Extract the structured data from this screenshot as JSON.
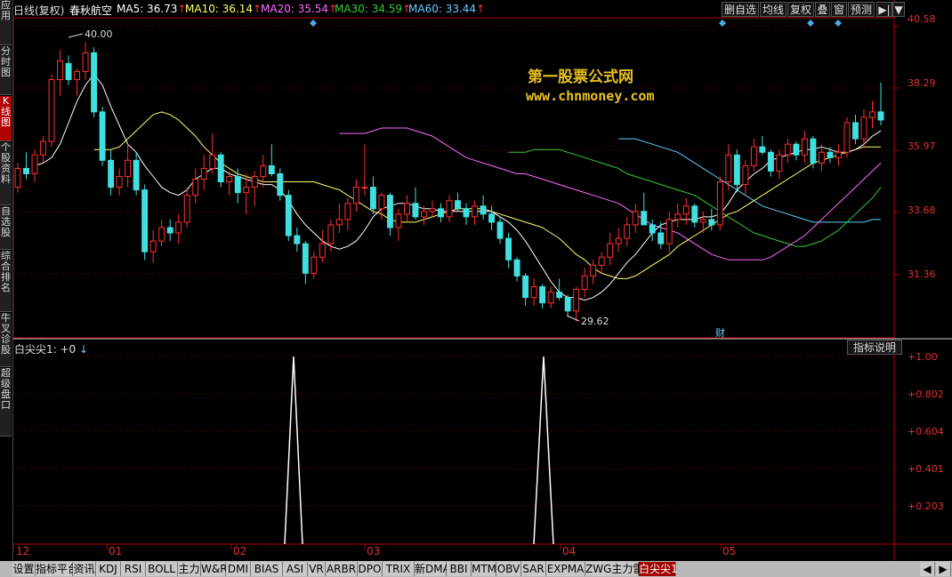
{
  "sidebar": {
    "items": [
      {
        "label": "应用",
        "active": false
      },
      {
        "label": "分时图",
        "active": false
      },
      {
        "label": "K线图",
        "active": true
      },
      {
        "label": "个股资料",
        "active": false
      },
      {
        "label": "自选股",
        "active": false
      },
      {
        "label": "综合排名",
        "active": false
      },
      {
        "label": "牛叉诊股",
        "active": false
      },
      {
        "label": "超级盘口",
        "active": false
      }
    ]
  },
  "header": {
    "period": "日线(复权)",
    "stock": "春秋航空",
    "ma5": {
      "label": "MA5: 36.73",
      "color": "#ffffff"
    },
    "ma10": {
      "label": "MA10: 36.14",
      "color": "#ffff66"
    },
    "ma20": {
      "label": "MA20: 35.54",
      "color": "#ff66ff"
    },
    "ma30": {
      "label": "MA30: 34.59",
      "color": "#33cc33"
    },
    "ma60": {
      "label": "MA60: 33.44",
      "color": "#66ccff"
    },
    "arrow": "↑"
  },
  "toolbar": {
    "buttons": [
      "删自选",
      "均线",
      "复权",
      "叠",
      "窗",
      "预测"
    ],
    "nav": "▶|",
    "dropdown": "▼"
  },
  "watermark": {
    "title": "第一股票公式网",
    "url": "www.chnmoney.com"
  },
  "price_axis": [
    "40.58",
    "38.29",
    "35.97",
    "33.68",
    "31.36"
  ],
  "annotations": {
    "high": "40.00",
    "low": "29.62",
    "fin": "财"
  },
  "indicator": {
    "title": "白尖尖1: +0",
    "arrow": "↓",
    "help_button": "指标说明",
    "axis": [
      "+1.00",
      "+0.802",
      "+0.604",
      "+0.401",
      "+0.203"
    ]
  },
  "months": [
    "12",
    "01",
    "02",
    "03",
    "04",
    "05"
  ],
  "tabs": [
    "设置",
    "指标平台",
    "资讯",
    "KDJ",
    "RSI",
    "BOLL",
    "主力",
    "W&R",
    "DMI",
    "BIAS",
    "ASI",
    "VR",
    "ARBR",
    "DPO",
    "TRIX",
    "新DMA",
    "BBI",
    "MTM",
    "OBV",
    "SAR",
    "EXPMA",
    "ZWG主力雷达",
    "白尖尖1"
  ],
  "active_tab": "白尖尖1",
  "colors": {
    "up": "#ff3030",
    "down": "#40e0e0",
    "grid": "#7a0000",
    "axis": "#b00000"
  },
  "chart_data": {
    "type": "candlestick",
    "ylim": [
      29.0,
      40.9
    ],
    "candles": [
      [
        34.6,
        35.5,
        34.4,
        35.3
      ],
      [
        35.3,
        35.9,
        34.9,
        35.1
      ],
      [
        35.1,
        36.0,
        34.8,
        35.8
      ],
      [
        35.8,
        36.5,
        35.5,
        36.3
      ],
      [
        36.3,
        38.8,
        36.1,
        38.6
      ],
      [
        38.6,
        39.7,
        38.0,
        39.3
      ],
      [
        39.2,
        39.5,
        38.4,
        38.6
      ],
      [
        38.6,
        39.0,
        38.0,
        38.9
      ],
      [
        38.9,
        40.0,
        38.6,
        39.6
      ],
      [
        39.6,
        39.8,
        37.2,
        37.4
      ],
      [
        37.4,
        37.6,
        35.4,
        35.6
      ],
      [
        35.6,
        36.0,
        34.3,
        34.6
      ],
      [
        34.6,
        35.3,
        34.3,
        35.0
      ],
      [
        35.0,
        36.2,
        34.6,
        35.6
      ],
      [
        35.6,
        35.9,
        34.3,
        34.5
      ],
      [
        34.5,
        34.7,
        31.9,
        32.2
      ],
      [
        32.2,
        33.0,
        31.8,
        32.6
      ],
      [
        32.6,
        33.4,
        32.4,
        33.1
      ],
      [
        33.1,
        33.4,
        32.6,
        32.9
      ],
      [
        32.9,
        33.6,
        32.5,
        33.3
      ],
      [
        33.3,
        34.6,
        33.1,
        34.3
      ],
      [
        34.3,
        35.3,
        34.0,
        34.9
      ],
      [
        34.9,
        35.8,
        34.5,
        35.3
      ],
      [
        35.3,
        36.6,
        35.1,
        35.8
      ],
      [
        35.8,
        35.9,
        34.6,
        34.8
      ],
      [
        34.8,
        35.2,
        34.3,
        35.0
      ],
      [
        35.0,
        35.3,
        34.0,
        34.4
      ],
      [
        34.4,
        35.1,
        33.6,
        34.6
      ],
      [
        34.6,
        35.2,
        33.9,
        35.0
      ],
      [
        35.0,
        35.8,
        34.6,
        35.4
      ],
      [
        35.4,
        36.2,
        35.0,
        35.1
      ],
      [
        35.1,
        35.3,
        34.1,
        34.3
      ],
      [
        34.3,
        34.5,
        32.6,
        32.8
      ],
      [
        32.8,
        33.1,
        32.2,
        32.5
      ],
      [
        32.5,
        32.6,
        31.0,
        31.4
      ],
      [
        31.4,
        32.2,
        31.2,
        32.0
      ],
      [
        32.0,
        33.0,
        31.8,
        32.5
      ],
      [
        32.5,
        33.4,
        32.2,
        33.2
      ],
      [
        33.2,
        34.0,
        32.9,
        33.4
      ],
      [
        33.4,
        34.2,
        33.0,
        34.0
      ],
      [
        34.0,
        34.9,
        33.7,
        34.6
      ],
      [
        34.6,
        36.2,
        34.3,
        34.6
      ],
      [
        34.6,
        35.0,
        33.6,
        33.8
      ],
      [
        33.8,
        34.4,
        33.4,
        34.3
      ],
      [
        34.3,
        34.4,
        32.8,
        33.1
      ],
      [
        33.1,
        33.8,
        32.6,
        33.6
      ],
      [
        33.6,
        34.3,
        33.3,
        34.0
      ],
      [
        34.0,
        34.6,
        33.4,
        33.5
      ],
      [
        33.5,
        33.9,
        33.2,
        33.7
      ],
      [
        33.7,
        34.1,
        33.5,
        33.8
      ],
      [
        33.8,
        34.0,
        33.3,
        33.5
      ],
      [
        33.5,
        34.3,
        33.3,
        34.1
      ],
      [
        34.1,
        34.4,
        33.7,
        33.8
      ],
      [
        33.8,
        34.0,
        33.2,
        33.5
      ],
      [
        33.5,
        34.1,
        33.2,
        33.9
      ],
      [
        33.9,
        34.3,
        33.4,
        33.6
      ],
      [
        33.6,
        33.9,
        33.0,
        33.3
      ],
      [
        33.3,
        33.5,
        32.5,
        32.7
      ],
      [
        32.7,
        32.9,
        31.6,
        31.9
      ],
      [
        31.9,
        32.0,
        31.1,
        31.3
      ],
      [
        31.3,
        31.4,
        30.2,
        30.5
      ],
      [
        30.5,
        31.2,
        30.2,
        30.9
      ],
      [
        30.9,
        31.0,
        30.1,
        30.3
      ],
      [
        30.3,
        30.9,
        30.1,
        30.7
      ],
      [
        30.7,
        31.2,
        30.4,
        30.5
      ],
      [
        30.5,
        30.6,
        29.8,
        30.0
      ],
      [
        30.0,
        30.9,
        29.6,
        30.8
      ],
      [
        30.8,
        31.6,
        30.5,
        31.3
      ],
      [
        31.3,
        31.9,
        31.0,
        31.7
      ],
      [
        31.7,
        32.2,
        31.4,
        32.0
      ],
      [
        32.0,
        32.9,
        31.7,
        32.5
      ],
      [
        32.5,
        33.1,
        32.2,
        32.7
      ],
      [
        32.7,
        33.5,
        32.4,
        33.2
      ],
      [
        33.2,
        34.0,
        32.9,
        33.7
      ],
      [
        33.7,
        34.4,
        33.4,
        33.2
      ],
      [
        33.2,
        33.4,
        32.6,
        32.9
      ],
      [
        32.9,
        33.3,
        32.3,
        32.5
      ],
      [
        32.5,
        33.7,
        32.2,
        33.4
      ],
      [
        33.4,
        34.0,
        33.1,
        33.6
      ],
      [
        33.6,
        34.2,
        33.2,
        33.9
      ],
      [
        33.9,
        34.0,
        33.1,
        33.3
      ],
      [
        33.3,
        33.7,
        32.9,
        33.4
      ],
      [
        33.4,
        33.8,
        33.0,
        33.2
      ],
      [
        33.2,
        35.0,
        33.0,
        34.8
      ],
      [
        34.8,
        36.2,
        34.5,
        35.8
      ],
      [
        35.8,
        36.0,
        34.4,
        34.7
      ],
      [
        34.7,
        35.6,
        34.3,
        35.4
      ],
      [
        35.4,
        36.4,
        35.2,
        36.1
      ],
      [
        36.1,
        36.5,
        35.8,
        35.9
      ],
      [
        35.9,
        36.0,
        35.0,
        35.2
      ],
      [
        35.2,
        36.0,
        34.9,
        35.8
      ],
      [
        35.8,
        36.4,
        35.5,
        36.2
      ],
      [
        36.2,
        36.3,
        35.6,
        35.8
      ],
      [
        35.8,
        36.7,
        35.5,
        36.4
      ],
      [
        36.4,
        36.5,
        35.3,
        35.5
      ],
      [
        35.5,
        36.2,
        35.2,
        35.9
      ],
      [
        35.9,
        36.1,
        35.5,
        35.7
      ],
      [
        35.7,
        36.2,
        35.4,
        35.9
      ],
      [
        35.9,
        37.2,
        35.7,
        37.0
      ],
      [
        37.0,
        37.3,
        36.2,
        36.4
      ],
      [
        36.4,
        37.5,
        36.1,
        37.2
      ],
      [
        37.2,
        37.8,
        36.8,
        37.4
      ],
      [
        37.4,
        38.5,
        36.9,
        37.1
      ]
    ],
    "ma5": [
      35.4,
      35.5,
      35.7,
      36.2,
      37.0,
      37.8,
      38.4,
      38.8,
      38.4,
      37.6,
      36.9,
      36.2,
      35.9,
      35.4,
      35.0,
      34.6,
      34.4,
      34.3,
      34.5,
      34.9,
      35.1,
      35.3,
      35.3,
      35.1,
      35.0,
      34.9,
      34.8,
      34.7,
      34.7,
      34.5,
      34.1,
      33.6,
      33.2,
      32.9,
      32.6,
      32.4,
      32.3,
      32.4,
      32.6,
      33.0,
      33.5,
      33.8,
      33.9,
      34.0,
      34.0,
      33.9,
      33.8,
      33.8,
      33.7,
      33.7,
      33.7,
      33.7,
      33.7,
      33.7,
      33.7,
      33.5,
      33.3,
      33.0,
      32.6,
      32.1,
      31.6,
      31.1,
      30.7,
      30.5,
      30.5,
      30.4,
      30.5,
      30.7,
      31.0,
      31.4,
      31.8,
      32.1,
      32.5,
      32.9,
      33.2,
      33.3,
      33.4,
      33.4,
      33.4,
      33.5,
      33.5,
      33.6,
      34.0,
      34.5,
      34.8,
      35.1,
      35.3,
      35.6,
      35.7,
      35.8,
      35.9,
      36.0,
      36.0,
      36.1,
      36.0,
      35.9,
      35.9,
      36.0,
      36.2,
      36.5,
      36.7
    ],
    "ma10": [
      36.0,
      36.0,
      36.0,
      36.1,
      36.4,
      36.7,
      37.0,
      37.3,
      37.4,
      37.3,
      37.1,
      36.8,
      36.5,
      36.1,
      35.8,
      35.5,
      35.3,
      35.1,
      35.0,
      34.9,
      34.8,
      34.8,
      34.8,
      34.8,
      34.8,
      34.8,
      34.8,
      34.7,
      34.6,
      34.5,
      34.3,
      34.1,
      33.9,
      33.7,
      33.6,
      33.4,
      33.3,
      33.3,
      33.3,
      33.4,
      33.5,
      33.6,
      33.7,
      33.8,
      33.8,
      33.8,
      33.8,
      33.7,
      33.6,
      33.5,
      33.4,
      33.3,
      33.2,
      33.1,
      32.9,
      32.7,
      32.4,
      32.1,
      31.9,
      31.6,
      31.4,
      31.3,
      31.2,
      31.2,
      31.3,
      31.5,
      31.7,
      31.9,
      32.1,
      32.4,
      32.6,
      32.8,
      33.0,
      33.2,
      33.4,
      33.6,
      33.7,
      33.9,
      34.1,
      34.3,
      34.5,
      34.7,
      34.9,
      35.1,
      35.3,
      35.5,
      35.6,
      35.7,
      35.8,
      35.9,
      36.0,
      36.1,
      36.1,
      36.1
    ],
    "ma20": [
      36.6,
      36.6,
      36.6,
      36.6,
      36.7,
      36.8,
      36.8,
      36.8,
      36.8,
      36.7,
      36.6,
      36.5,
      36.3,
      36.1,
      35.9,
      35.7,
      35.6,
      35.5,
      35.4,
      35.3,
      35.2,
      35.1,
      35.1,
      35.0,
      34.9,
      34.8,
      34.7,
      34.6,
      34.5,
      34.4,
      34.3,
      34.2,
      34.1,
      34.0,
      33.8,
      33.6,
      33.4,
      33.2,
      33.1,
      33.0,
      32.9,
      32.7,
      32.5,
      32.3,
      32.1,
      32.0,
      31.9,
      31.9,
      31.9,
      31.9,
      31.9,
      32.0,
      32.2,
      32.4,
      32.6,
      32.8,
      33.1,
      33.4,
      33.7,
      34.0,
      34.3,
      34.6,
      34.9,
      35.2,
      35.5
    ],
    "ma30": [
      35.9,
      35.9,
      35.9,
      36.0,
      36.0,
      36.0,
      36.0,
      35.9,
      35.8,
      35.7,
      35.6,
      35.5,
      35.4,
      35.3,
      35.1,
      35.0,
      34.9,
      34.8,
      34.7,
      34.6,
      34.5,
      34.4,
      34.3,
      34.1,
      33.9,
      33.7,
      33.5,
      33.3,
      33.1,
      32.9,
      32.8,
      32.7,
      32.6,
      32.5,
      32.4,
      32.4,
      32.5,
      32.6,
      32.8,
      33.0,
      33.3,
      33.6,
      33.9,
      34.2,
      34.6
    ],
    "ma60": [
      36.4,
      36.4,
      36.4,
      36.3,
      36.2,
      36.1,
      36.0,
      35.9,
      35.7,
      35.5,
      35.3,
      35.1,
      34.9,
      34.7,
      34.5,
      34.3,
      34.1,
      33.9,
      33.8,
      33.7,
      33.6,
      33.5,
      33.4,
      33.3,
      33.3,
      33.3,
      33.3,
      33.3,
      33.3,
      33.3,
      33.4,
      33.4
    ],
    "indicator_values": {
      "spikes": [
        1.0,
        1.0
      ],
      "ylim": [
        0,
        1.0
      ]
    }
  }
}
